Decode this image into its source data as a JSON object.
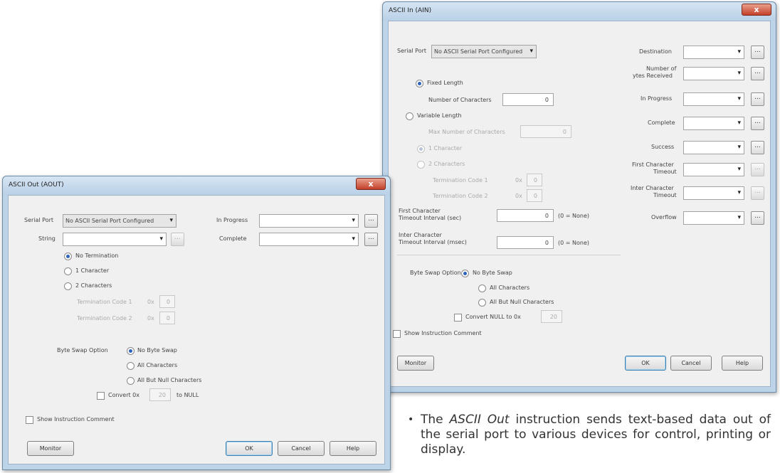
{
  "ascii_out": {
    "title": "ASCII Out (AOUT)",
    "close": "x",
    "serial_port_label": "Serial Port",
    "serial_port_value": "No ASCII Serial Port Configured",
    "string_label": "String",
    "in_progress_label": "In Progress",
    "complete_label": "Complete",
    "no_termination": "No Termination",
    "one_character": "1 Character",
    "two_characters": "2 Characters",
    "term_code_1_label": "Termination Code 1",
    "term_code_2_label": "Termination Code 2",
    "hex_prefix": "0x",
    "term_code_1_value": "0",
    "term_code_2_value": "0",
    "byte_swap_label": "Byte Swap Option",
    "no_byte_swap": "No Byte Swap",
    "all_characters": "All Characters",
    "all_but_null": "All But Null Characters",
    "convert_label": "Convert 0x",
    "convert_value": "20",
    "convert_suffix": "to NULL",
    "show_comment": "Show Instruction Comment",
    "monitor": "Monitor",
    "ok": "OK",
    "cancel": "Cancel",
    "help": "Help",
    "ellipsis": "..."
  },
  "ascii_in": {
    "title": "ASCII In (AIN)",
    "close": "x",
    "serial_port_label": "Serial Port",
    "serial_port_value": "No ASCII Serial Port Configured",
    "fixed_length": "Fixed Length",
    "num_characters_label": "Number of Characters",
    "num_characters_value": "0",
    "variable_length": "Variable Length",
    "max_characters_label": "Max Number of Characters",
    "max_characters_value": "0",
    "one_character": "1 Character",
    "two_characters": "2 Characters",
    "term_code_1_label": "Termination Code 1",
    "term_code_2_label": "Termination Code 2",
    "hex_prefix": "0x",
    "term_code_1_value": "0",
    "term_code_2_value": "0",
    "first_char_timeout_label_1": "First Character",
    "first_char_timeout_label_2": "Timeout Interval (sec)",
    "first_char_timeout_value": "0",
    "first_char_timeout_note": "(0 = None)",
    "inter_char_timeout_label_1": "Inter Character",
    "inter_char_timeout_label_2": "Timeout Interval (msec)",
    "inter_char_timeout_value": "0",
    "inter_char_timeout_note": "(0 = None)",
    "byte_swap_label": "Byte Swap Option",
    "no_byte_swap": "No Byte Swap",
    "all_characters": "All Characters",
    "all_but_null": "All But Null Characters",
    "convert_label": "Convert NULL to 0x",
    "convert_value": "20",
    "show_comment": "Show Instruction Comment",
    "monitor": "Monitor",
    "ok": "OK",
    "cancel": "Cancel",
    "help": "Help",
    "ellipsis": "...",
    "right_fields": {
      "destination": "Destination",
      "num_bytes_1": "Number of",
      "num_bytes_2": "ytes Received",
      "in_progress": "In Progress",
      "complete": "Complete",
      "success": "Success",
      "first_char_timeout_1": "First Character",
      "first_char_timeout_2": "Timeout",
      "inter_char_timeout_1": "Inter Character",
      "inter_char_timeout_2": "Timeout",
      "overflow": "Overflow"
    }
  },
  "description": {
    "bullet": "•",
    "text_before": "The ",
    "instruction": "ASCII Out",
    "text_after": " instruction sends text-based data out of the serial port to various devices for control, printing or display."
  },
  "icons": {
    "dropdown": "▾",
    "bullet": "•"
  },
  "colors": {
    "title_bar": "#bcd3e8",
    "client": "#f0f0f0",
    "close_button": "#c4402a",
    "radio_selected": "#2e63b8"
  }
}
